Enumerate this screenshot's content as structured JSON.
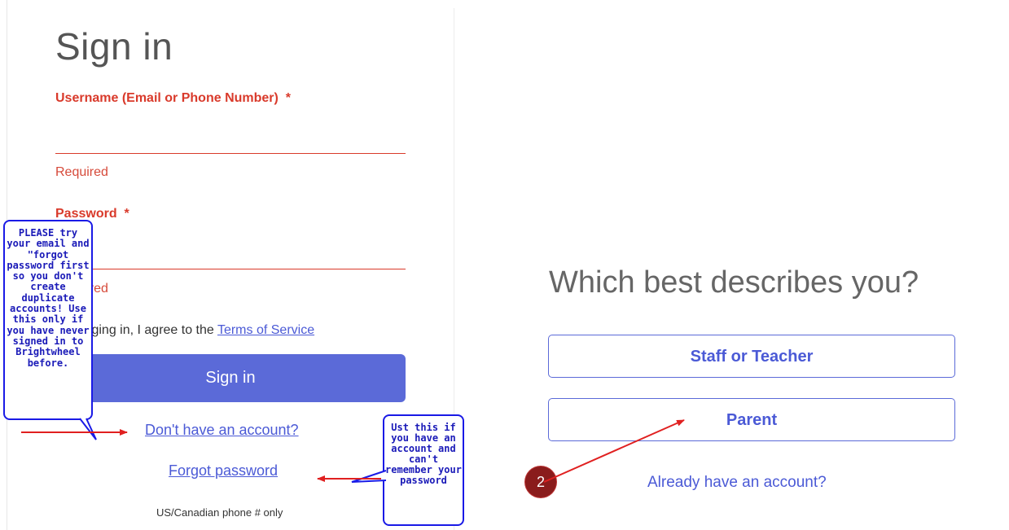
{
  "signin": {
    "title": "Sign in",
    "username_label": "Username (Email or Phone Number)",
    "password_label": "Password",
    "required_mark": "*",
    "username_error": "Required",
    "password_error": "Required",
    "agree_prefix": "By logging in, I agree to the",
    "terms_link": "Terms of Service",
    "signin_button": "Sign in",
    "no_account_link": "Don't have an account?",
    "forgot_link": "Forgot password",
    "phone_note": "US/Canadian phone # only"
  },
  "annotations": {
    "callout_left": "PLEASE try your email and \"forgot password first so you don't create duplicate accounts! Use this only if you have never signed in to Brightwheel before.",
    "callout_right": "Ust this if you have an account and can't remember your password",
    "badge_number": "2",
    "arrow_color": "#e02020",
    "callout_color": "#1a1ae6"
  },
  "role_select": {
    "title": "Which best describes you?",
    "staff_button": "Staff or Teacher",
    "parent_button": "Parent",
    "existing_account_link": "Already have an account?"
  },
  "colors": {
    "accent": "#5b6ad8",
    "error": "#d93a2b",
    "badge": "#8a1c1c"
  }
}
